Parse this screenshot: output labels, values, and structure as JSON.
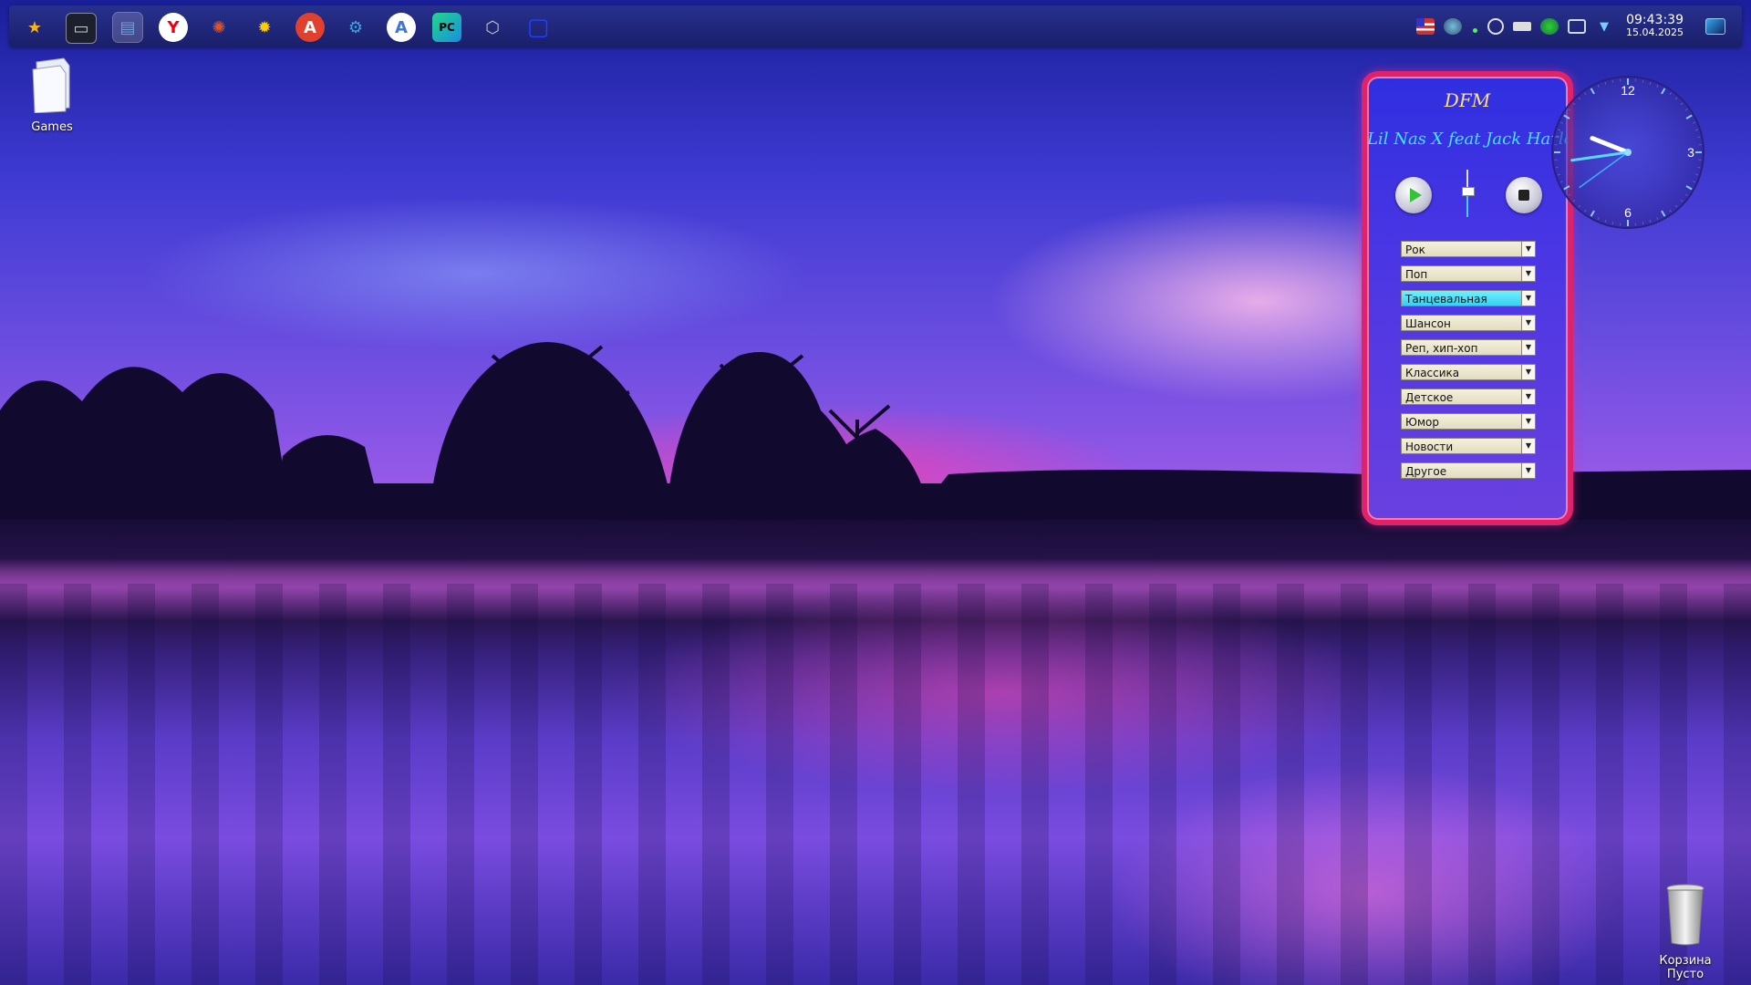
{
  "desktop": {
    "icons": [
      {
        "label": "Games",
        "icon": "folder-icon"
      },
      {
        "label": "Корзина",
        "sublabel": "Пусто",
        "icon": "trash-icon"
      }
    ]
  },
  "taskbar": {
    "apps": [
      {
        "name": "favorites",
        "icon": "star-icon",
        "color": "#f5b21a"
      },
      {
        "name": "terminal",
        "icon": "terminal-icon",
        "color": "#1b1f2e"
      },
      {
        "name": "file-manager",
        "icon": "file-manager-icon",
        "color": "#6f9ed8",
        "active": true
      },
      {
        "name": "yandex-browser",
        "icon": "yandex-icon",
        "color": "#ffffff"
      },
      {
        "name": "app-orange",
        "icon": "burst-icon",
        "color": "#e2541e"
      },
      {
        "name": "app-sun",
        "icon": "sun-icon",
        "color": "#ffcc00"
      },
      {
        "name": "translator",
        "icon": "translate-icon",
        "color": "#e0402e"
      },
      {
        "name": "settings",
        "icon": "gear-icon",
        "color": "#3aa8e0"
      },
      {
        "name": "app-store",
        "icon": "appstore-icon",
        "color": "#3a74e0"
      },
      {
        "name": "pycharm",
        "icon": "pycharm-icon",
        "color": "#21d789"
      },
      {
        "name": "unity",
        "icon": "cube-icon",
        "color": "#c8c8c8"
      },
      {
        "name": "display",
        "icon": "monitor-icon",
        "color": "#2040ff"
      }
    ],
    "tray": {
      "time": "09:43:39",
      "date": "15.04.2025",
      "icons": [
        "flag-us-icon",
        "globe-icon",
        "network-icon",
        "disc-icon",
        "battery-icon",
        "earth-icon",
        "display-icon",
        "chevron-down-icon",
        "desktop-icon"
      ]
    }
  },
  "player": {
    "title": "DFM",
    "track": "Lil Nas X feat Jack Harlow",
    "volume_fraction": 0.55,
    "genres": [
      {
        "label": "Рок",
        "selected": false
      },
      {
        "label": "Поп",
        "selected": false
      },
      {
        "label": "Танцевальная",
        "selected": true
      },
      {
        "label": "Шансон",
        "selected": false
      },
      {
        "label": "Реп, хип-хоп",
        "selected": false
      },
      {
        "label": "Классика",
        "selected": false
      },
      {
        "label": "Детское",
        "selected": false
      },
      {
        "label": "Юмор",
        "selected": false
      },
      {
        "label": "Новости",
        "selected": false
      },
      {
        "label": "Другое",
        "selected": false
      }
    ],
    "accent_color": "#e0226a"
  },
  "analog_clock": {
    "hours": 9,
    "minutes": 43,
    "seconds": 39,
    "numerals": [
      "12",
      "3",
      "6"
    ]
  }
}
